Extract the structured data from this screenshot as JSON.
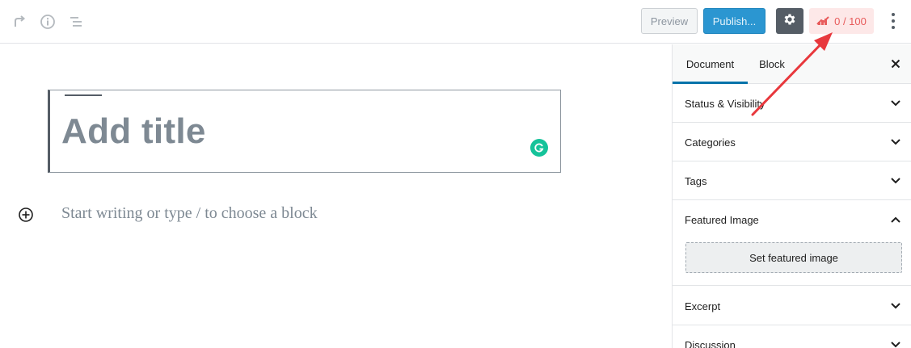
{
  "toolbar": {
    "redo_icon": "redo-icon",
    "info_icon": "info-icon",
    "outline_icon": "list-outline-icon",
    "preview_label": "Preview",
    "publish_label": "Publish...",
    "settings_icon": "gear-icon",
    "score_icon": "seo-score-icon",
    "score_label": "0 / 100",
    "more_icon": "vertical-ellipsis-icon"
  },
  "editor": {
    "title_placeholder": "Add title",
    "grammarly_icon": "grammarly-icon",
    "inserter_icon": "add-block-icon",
    "body_placeholder": "Start writing or type / to choose a block"
  },
  "sidebar": {
    "tabs": [
      {
        "label": "Document",
        "active": true
      },
      {
        "label": "Block",
        "active": false
      }
    ],
    "close_icon": "close-icon",
    "panels": [
      {
        "label": "Status & Visibility",
        "expanded": false
      },
      {
        "label": "Categories",
        "expanded": false
      },
      {
        "label": "Tags",
        "expanded": false
      },
      {
        "label": "Featured Image",
        "expanded": true
      },
      {
        "label": "Excerpt",
        "expanded": false
      },
      {
        "label": "Discussion",
        "expanded": false
      }
    ],
    "featured_button": "Set featured image"
  },
  "colors": {
    "accent_blue": "#0073aa",
    "publish_blue": "#2b96d1",
    "score_red": "#e85b5b",
    "annotation_arrow": "#e8383d",
    "grammarly_green": "#15c39a"
  }
}
